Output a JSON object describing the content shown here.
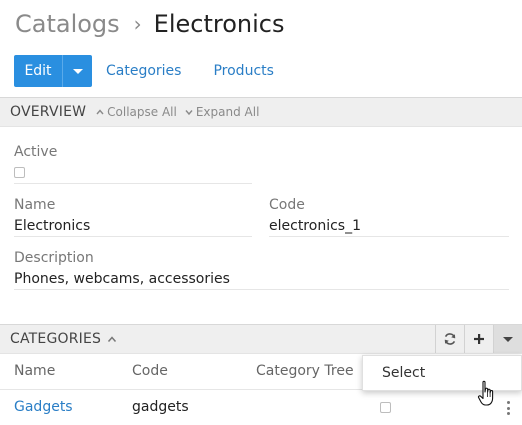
{
  "breadcrumb": {
    "parent": "Catalogs",
    "separator": "›",
    "current": "Electronics"
  },
  "toolbar": {
    "edit_label": "Edit",
    "links": [
      "Categories",
      "Products"
    ]
  },
  "overview": {
    "title": "OVERVIEW",
    "collapse_all": "Collapse All",
    "expand_all": "Expand All",
    "fields": {
      "active": {
        "label": "Active",
        "checked": false
      },
      "name": {
        "label": "Name",
        "value": "Electronics"
      },
      "code": {
        "label": "Code",
        "value": "electronics_1"
      },
      "description": {
        "label": "Description",
        "value": "Phones, webcams, accessories"
      }
    }
  },
  "categories": {
    "title": "CATEGORIES",
    "columns": [
      "Name",
      "Code",
      "Category Tree"
    ],
    "rows": [
      {
        "name": "Gadgets",
        "code": "gadgets",
        "category_tree": false
      }
    ],
    "dropdown": {
      "items": [
        "Select"
      ]
    }
  },
  "icons": {
    "refresh": "refresh-icon",
    "add": "plus-icon",
    "menu": "caret-down-icon",
    "collapse": "chevron-up-icon",
    "row_actions": "kebab-icon"
  },
  "colors": {
    "accent": "#2a8fe0",
    "link": "#2a7ec6",
    "section_bg": "#efefef"
  }
}
